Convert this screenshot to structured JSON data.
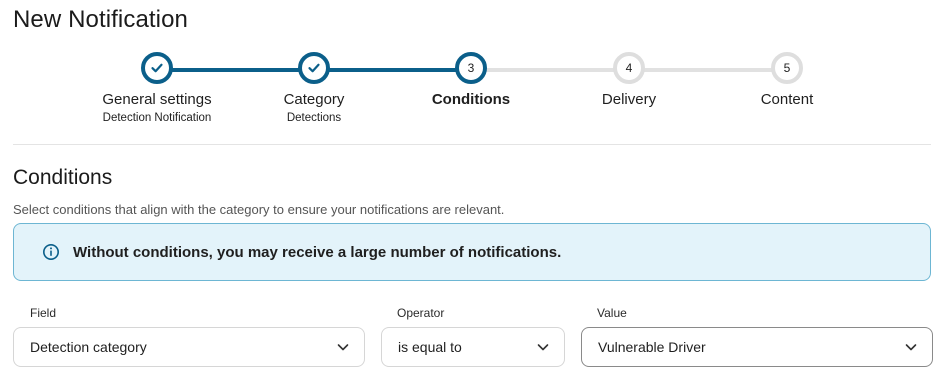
{
  "page": {
    "title": "New Notification"
  },
  "stepper": {
    "steps": [
      {
        "label": "General settings",
        "sublabel": "Detection Notification",
        "status": "done",
        "number": "1"
      },
      {
        "label": "Category",
        "sublabel": "Detections",
        "status": "done",
        "number": "2"
      },
      {
        "label": "Conditions",
        "sublabel": "",
        "status": "active",
        "number": "3"
      },
      {
        "label": "Delivery",
        "sublabel": "",
        "status": "todo",
        "number": "4"
      },
      {
        "label": "Content",
        "sublabel": "",
        "status": "todo",
        "number": "5"
      }
    ],
    "colors": {
      "done": "#0b5f8a",
      "todo": "#e1e1e1"
    }
  },
  "section": {
    "title": "Conditions",
    "description": "Select conditions that align with the category to ensure your notifications are relevant."
  },
  "alert": {
    "icon": "info-icon",
    "text": "Without conditions, you may receive a large number of notifications."
  },
  "condition": {
    "field": {
      "label": "Field",
      "value": "Detection category"
    },
    "operator": {
      "label": "Operator",
      "value": "is equal to"
    },
    "value": {
      "label": "Value",
      "value": "Vulnerable Driver"
    }
  }
}
